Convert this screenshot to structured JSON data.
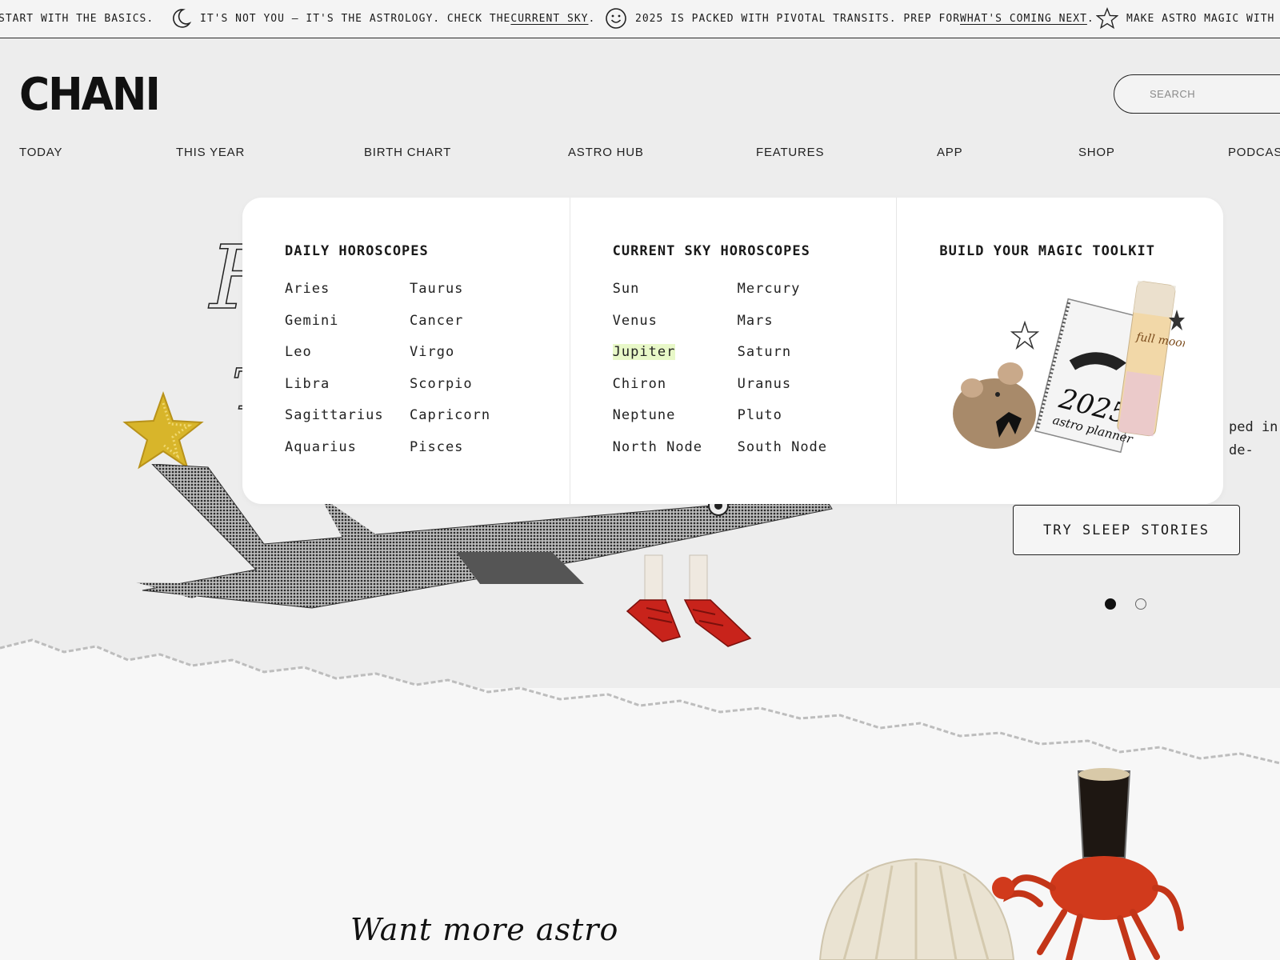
{
  "marquee": {
    "items": [
      {
        "text": "START WITH THE BASICS.",
        "icon": null,
        "link": "",
        "after": ""
      },
      {
        "text": "IT'S NOT YOU — IT'S THE ASTROLOGY. CHECK THE ",
        "icon": "crescent-moon-icon",
        "link": "CURRENT SKY",
        "after": "."
      },
      {
        "text": "2025 IS PACKED WITH PIVOTAL TRANSITS. PREP FOR ",
        "icon": "smiley-icon",
        "link": "WHAT'S COMING NEXT",
        "after": "."
      },
      {
        "text": "MAKE ASTRO MAGIC WITH T",
        "icon": "star-outline-icon",
        "link": "",
        "after": ""
      }
    ]
  },
  "header": {
    "logo": "CHANI",
    "search_placeholder": "SEARCH"
  },
  "nav": {
    "items": [
      "TODAY",
      "THIS YEAR",
      "BIRTH CHART",
      "ASTRO HUB",
      "FEATURES",
      "APP",
      "SHOP",
      "PODCAST"
    ]
  },
  "dropdown": {
    "daily": {
      "heading": "DAILY HOROSCOPES",
      "links": [
        "Aries",
        "Taurus",
        "Gemini",
        "Cancer",
        "Leo",
        "Virgo",
        "Libra",
        "Scorpio",
        "Sagittarius",
        "Capricorn",
        "Aquarius",
        "Pisces"
      ]
    },
    "current_sky": {
      "heading": "CURRENT SKY HOROSCOPES",
      "links": [
        "Sun",
        "Mercury",
        "Venus",
        "Mars",
        "Jupiter",
        "Saturn",
        "Chiron",
        "Uranus",
        "Neptune",
        "Pluto",
        "North Node",
        "South Node"
      ],
      "highlighted": "Jupiter",
      "highlight_color": "#e8f8c8"
    },
    "toolkit": {
      "heading": "BUILD YOUR MAGIC TOOLKIT",
      "planner_text_year": "2025",
      "planner_text_sub": "astro planner",
      "candle_text": "full moon"
    }
  },
  "hero": {
    "title_fragment_1": "F",
    "title_fragment_2": "T",
    "copy_line_1": "ped in",
    "copy_line_2": "de-",
    "cta_label": "TRY SLEEP STORIES",
    "dots": [
      true,
      false
    ]
  },
  "lower": {
    "headline": "Want more astro"
  },
  "colors": {
    "background": "#ededed",
    "ink": "#1a1a1a",
    "dropdown_bg": "#ffffff",
    "highlight": "#e8f8c8",
    "shoe_red": "#c8231b",
    "star_gold": "#d8b52a",
    "crab_red": "#d13a1c"
  }
}
